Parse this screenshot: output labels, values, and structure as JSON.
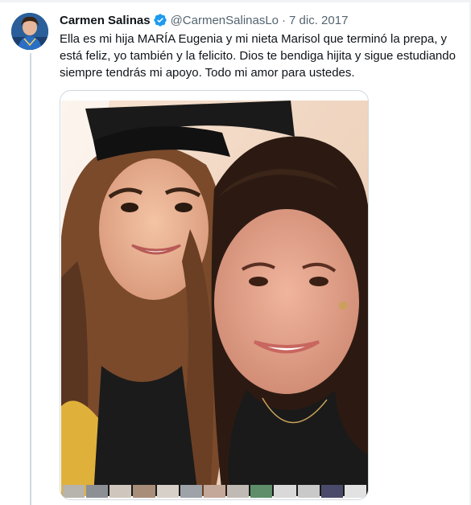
{
  "tweet": {
    "author_name": "Carmen Salinas",
    "handle": "@CarmenSalinasLo",
    "separator": "·",
    "date": "7 dic. 2017",
    "text": "Ella es mi hija MARÍA Eugenia y mi nieta Marisol que terminó la prepa, y está feliz, yo también y la felicito. Dios te bendiga hijita y sigue estudiando siempre tendrás mi apoyo. Todo mi amor para ustedes."
  },
  "icons": {
    "verified": "verified-badge-icon"
  },
  "colors": {
    "verified_blue": "#1d9bf0",
    "secondary_text": "#536471",
    "primary_text": "#0f1419",
    "border": "#cfd9de"
  }
}
